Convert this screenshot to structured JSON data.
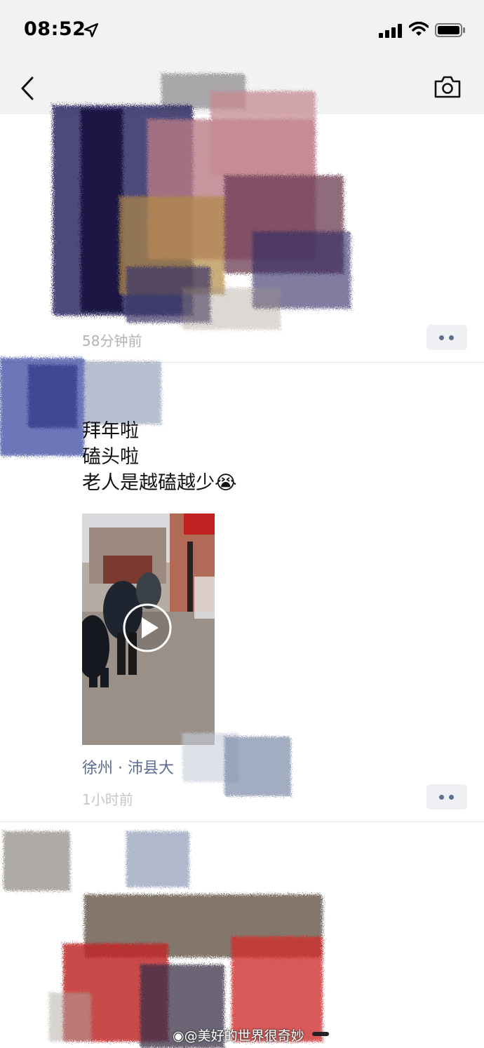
{
  "status_bar": {
    "time": "08:52"
  },
  "icons": {
    "location": "location-arrow-icon",
    "signal": "cellular-signal-icon",
    "wifi": "wifi-icon",
    "battery": "battery-icon",
    "back": "chevron-left-icon",
    "camera": "camera-icon",
    "more": "more-dots-icon",
    "play": "play-icon",
    "weibo": "weibo-logo-icon"
  },
  "posts": [
    {
      "time": "58分钟前"
    },
    {
      "lines": [
        "拜年啦",
        "磕头啦",
        "老人是越磕越少"
      ],
      "emoji": "😭",
      "location": "徐州 · 沛县大",
      "time": "1小时前"
    }
  ],
  "watermark": "@美好的世界很奇妙",
  "colors": {
    "link": "#5b6b91",
    "time": "#b3b3b3",
    "more_dots": "#5f6f8f",
    "bar_bg": "#f2f2f2"
  }
}
